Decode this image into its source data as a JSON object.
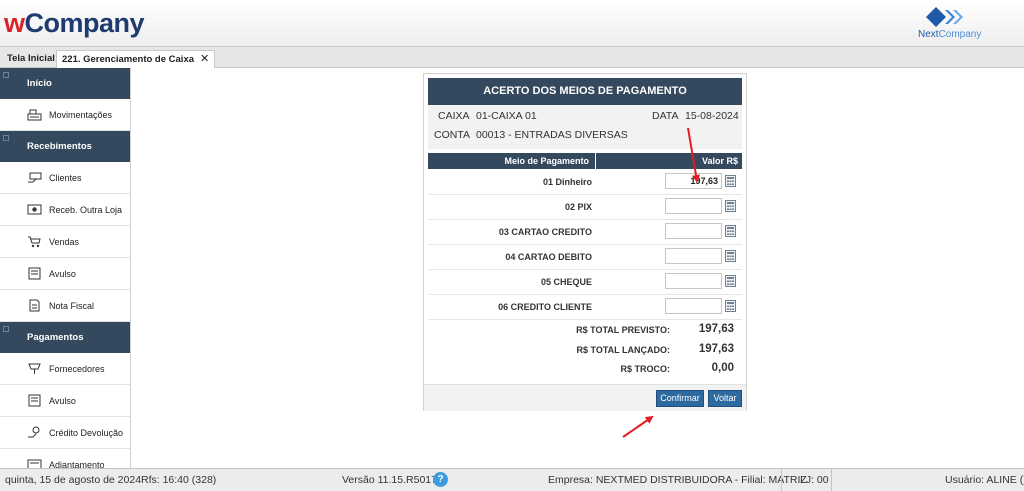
{
  "header": {
    "logo_w": "w",
    "logo_rest": "Company",
    "next_brand_a": "Next",
    "next_brand_b": "Company"
  },
  "tabs": {
    "home": "Tela Inicial",
    "active": "221. Gerenciamento de Caixa",
    "close": "✕"
  },
  "sidebar": {
    "sections": [
      {
        "title": "Início",
        "items": [
          "Movimentações"
        ]
      },
      {
        "title": "Recebimentos",
        "items": [
          "Clientes",
          "Receb. Outra Loja",
          "Vendas",
          "Avulso",
          "Nota Fiscal"
        ]
      },
      {
        "title": "Pagamentos",
        "items": [
          "Fornecedores",
          "Avulso",
          "Crédito Devolução",
          "Adiantamento"
        ]
      }
    ]
  },
  "panel": {
    "title": "ACERTO DOS MEIOS DE PAGAMENTO",
    "caixa_label": "CAIXA",
    "caixa_value": "01-CAIXA 01",
    "data_label": "DATA",
    "data_value": "15-08-2024",
    "conta_label": "CONTA",
    "conta_value": "00013 - ENTRADAS DIVERSAS",
    "col_method": "Meio de Pagamento",
    "col_value": "Valor R$",
    "rows": [
      {
        "label": "01 Dinheiro",
        "value": "197,63"
      },
      {
        "label": "02 PIX",
        "value": ""
      },
      {
        "label": "03 CARTAO CREDITO",
        "value": ""
      },
      {
        "label": "04 CARTAO DEBITO",
        "value": ""
      },
      {
        "label": "05 CHEQUE",
        "value": ""
      },
      {
        "label": "06 CREDITO CLIENTE",
        "value": ""
      }
    ],
    "totals": [
      {
        "label": "R$ TOTAL PREVISTO:",
        "value": "197,63"
      },
      {
        "label": "R$ TOTAL LANÇADO:",
        "value": "197,63"
      },
      {
        "label": "R$ TROCO:",
        "value": "0,00"
      }
    ],
    "confirm": "Confirmar",
    "back": "Voltar"
  },
  "status": {
    "datetime": "quinta, 15 de agosto de 2024",
    "rfs": "Rfs: 16:40 (328)",
    "version": "Versão 11.15.R5017",
    "help": "?",
    "empresa": "Empresa: NEXTMED DISTRIBUIDORA - Filial: MATRIZ",
    "lj": "LJ: 00",
    "usuario": "Usuário: ALINE ()"
  },
  "colors": {
    "dark_header": "#34495e",
    "button": "#2c6aa0",
    "arrow": "#e31b23",
    "logo_red": "#d9232b",
    "logo_blue": "#1f3a70"
  }
}
